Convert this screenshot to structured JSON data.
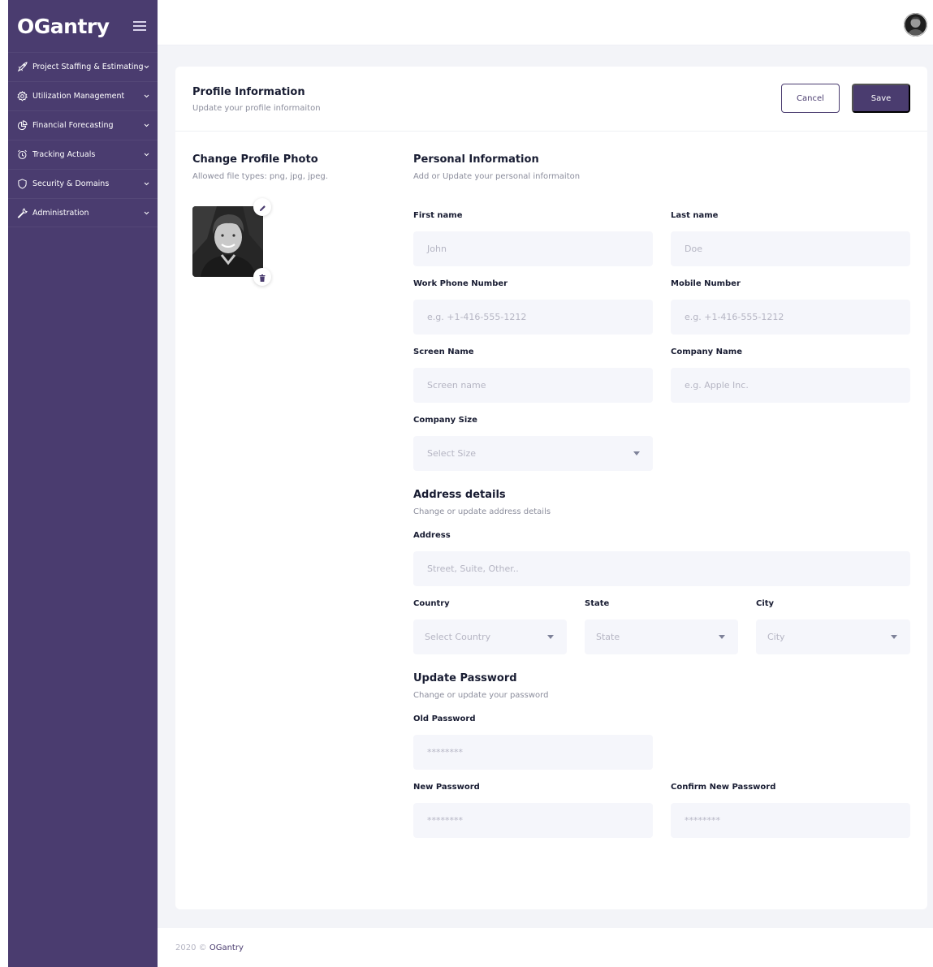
{
  "brand": {
    "logo_text": "OGantry"
  },
  "sidebar": {
    "items": [
      {
        "label": "Project Staffing & Estimating",
        "icon": "rocket-icon"
      },
      {
        "label": "Utilization Management",
        "icon": "gear-icon"
      },
      {
        "label": "Financial Forecasting",
        "icon": "pie-chart-icon"
      },
      {
        "label": "Tracking Actuals",
        "icon": "alarm-clock-icon"
      },
      {
        "label": "Security & Domains",
        "icon": "shield-icon"
      },
      {
        "label": "Administration",
        "icon": "wrench-icon"
      }
    ]
  },
  "header": {
    "title": "Profile Information",
    "subtitle": "Update your profile informaiton",
    "cancel_label": "Cancel",
    "save_label": "Save"
  },
  "photo_section": {
    "title": "Change Profile Photo",
    "subtitle": "Allowed file types: png, jpg, jpeg."
  },
  "personal": {
    "title": "Personal Information",
    "subtitle": "Add or Update your personal informaiton",
    "first_name_label": "First name",
    "first_name_placeholder": "John",
    "last_name_label": "Last name",
    "last_name_placeholder": "Doe",
    "work_phone_label": "Work Phone Number",
    "work_phone_placeholder": "e.g. +1-416-555-1212",
    "mobile_label": "Mobile Number",
    "mobile_placeholder": "e.g. +1-416-555-1212",
    "screen_name_label": "Screen Name",
    "screen_name_placeholder": "Screen name",
    "company_name_label": "Company Name",
    "company_name_placeholder": "e.g. Apple Inc.",
    "company_size_label": "Company Size",
    "company_size_value": "Select Size"
  },
  "address": {
    "title": "Address details",
    "subtitle": "Change or update address details",
    "address_label": "Address",
    "address_placeholder": "Street, Suite, Other..",
    "country_label": "Country",
    "country_value": "Select Country",
    "state_label": "State",
    "state_value": "State",
    "city_label": "City",
    "city_value": "City"
  },
  "password": {
    "title": "Update Password",
    "subtitle": "Change or update your password",
    "old_label": "Old Password",
    "old_placeholder": "********",
    "new_label": "New Password",
    "new_placeholder": "********",
    "confirm_label": "Confirm New Password",
    "confirm_placeholder": "********"
  },
  "footer": {
    "year": "2020 ©",
    "link": "OGantry"
  },
  "colors": {
    "brand": "#4a3c6f",
    "field_bg": "#f5f6fb",
    "page_bg": "#f3f4f8"
  }
}
